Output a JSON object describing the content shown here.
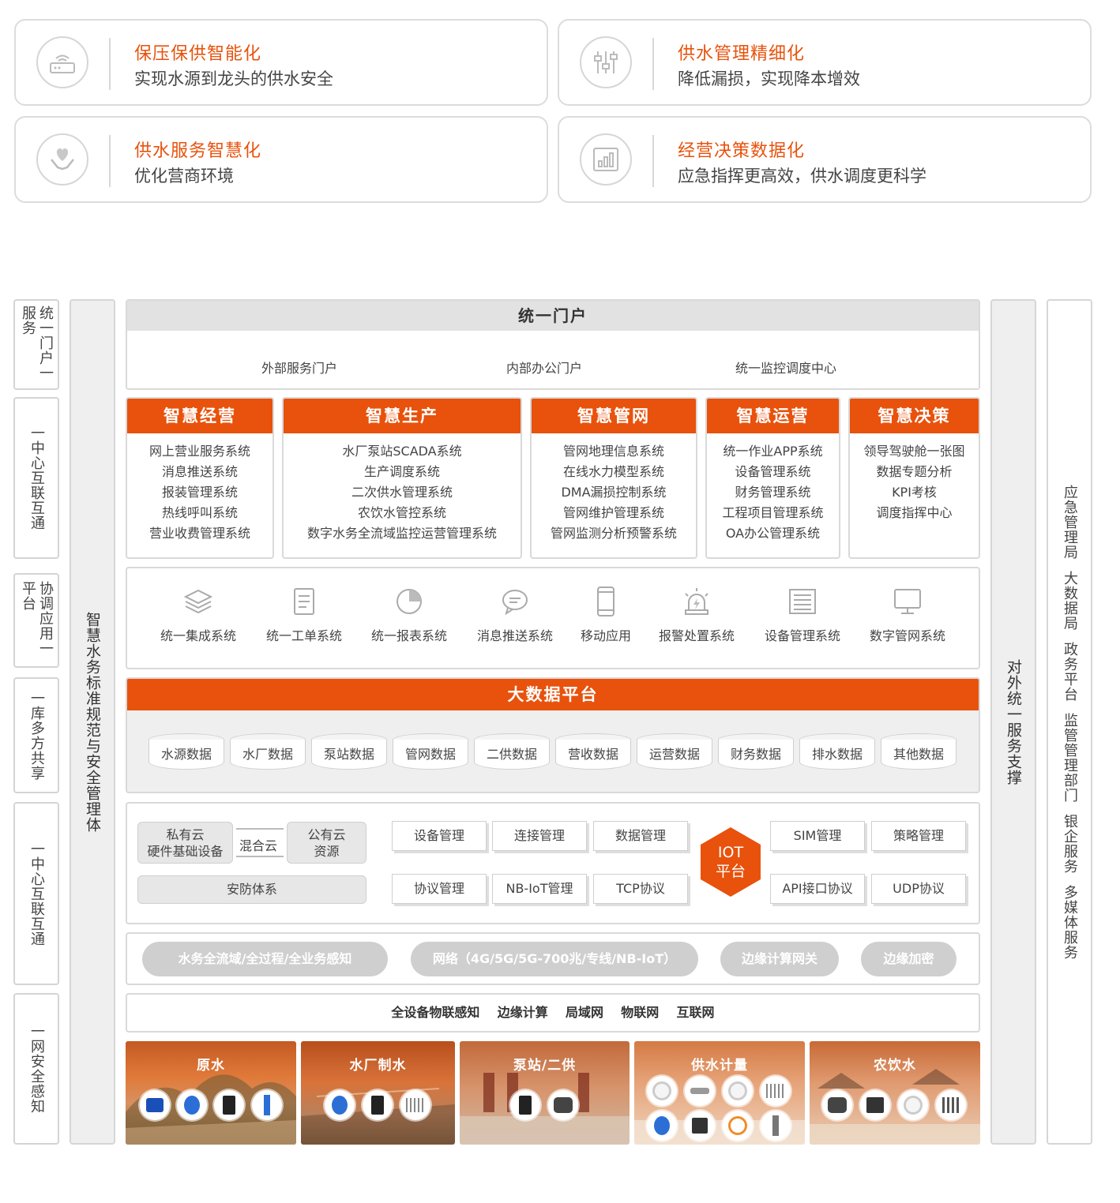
{
  "cards": [
    {
      "title": "保压保供智能化",
      "subtitle": "实现水源到龙头的供水安全",
      "icon": "router-icon"
    },
    {
      "title": "供水管理精细化",
      "subtitle": "降低漏损，实现降本增效",
      "icon": "sliders-icon"
    },
    {
      "title": "供水服务智慧化",
      "subtitle": "优化营商环境",
      "icon": "heart-hands-icon"
    },
    {
      "title": "经营决策数据化",
      "subtitle": "应急指挥更高效，供水调度更科学",
      "icon": "bar-chart-icon"
    }
  ],
  "left_labels": [
    "统一门户一服务",
    "一中心互联互通",
    "协调应用一平台",
    "一库多方共享",
    "一中心互联互通",
    "一网安全感知"
  ],
  "standards_column": "智慧水务标准规范与安全管理体",
  "portal": {
    "title": "统一门户",
    "items": [
      "外部服务门户",
      "内部办公门户",
      "统一监控调度中心"
    ]
  },
  "modules": [
    {
      "title": "智慧经营",
      "items": [
        "网上营业服务系统",
        "消息推送系统",
        "报装管理系统",
        "热线呼叫系统",
        "营业收费管理系统"
      ]
    },
    {
      "title": "智慧生产",
      "items": [
        "水厂泵站SCADA系统",
        "生产调度系统",
        "二次供水管理系统",
        "农饮水管控系统",
        "数字水务全流域监控运营管理系统"
      ]
    },
    {
      "title": "智慧管网",
      "items": [
        "管网地理信息系统",
        "在线水力模型系统",
        "DMA漏损控制系统",
        "管网维护管理系统",
        "管网监测分析预警系统"
      ]
    },
    {
      "title": "智慧运营",
      "items": [
        "统一作业APP系统",
        "设备管理系统",
        "财务管理系统",
        "工程项目管理系统",
        "OA办公管理系统"
      ]
    },
    {
      "title": "智慧决策",
      "items": [
        "领导驾驶舱一张图",
        "数据专题分析",
        "KPI考核",
        "调度指挥中心"
      ]
    }
  ],
  "apps": [
    {
      "label": "统一集成系统",
      "icon": "layers-icon"
    },
    {
      "label": "统一工单系统",
      "icon": "document-icon"
    },
    {
      "label": "统一报表系统",
      "icon": "pie-chart-icon"
    },
    {
      "label": "消息推送系统",
      "icon": "chat-bubble-icon"
    },
    {
      "label": "移动应用",
      "icon": "mobile-phone-icon"
    },
    {
      "label": "报警处置系统",
      "icon": "alarm-light-icon"
    },
    {
      "label": "设备管理系统",
      "icon": "list-panel-icon"
    },
    {
      "label": "数字管网系统",
      "icon": "monitor-icon"
    }
  ],
  "bigdata": {
    "title": "大数据平台",
    "items": [
      "水源数据",
      "水厂数据",
      "泵站数据",
      "管网数据",
      "二供数据",
      "营收数据",
      "运营数据",
      "财务数据",
      "排水数据",
      "其他数据"
    ]
  },
  "cloud": {
    "private_line1": "私有云",
    "private_line2": "硬件基础设备",
    "hybrid": "混合云",
    "public_line1": "公有云",
    "public_line2": "资源",
    "security": "安防体系"
  },
  "iot": {
    "hub_line1": "IOT",
    "hub_line2": "平台",
    "left_top": [
      "设备管理",
      "连接管理",
      "数据管理"
    ],
    "left_bottom": [
      "协议管理",
      "NB-IoT管理",
      "TCP协议"
    ],
    "right_top": [
      "SIM管理",
      "策略管理"
    ],
    "right_bottom": [
      "API接口协议",
      "UDP协议"
    ]
  },
  "network_pills": [
    "水务全流域/全过程/全业务感知",
    "网络（4G/5G/5G-700兆/专线/NB-IoT）",
    "边缘计算网关",
    "边缘加密"
  ],
  "sensing_line": "全设备物联感知    边缘计算    局域网    物联网    互联网",
  "scenes": [
    "原水",
    "水厂制水",
    "泵站/二供",
    "供水计量",
    "农饮水"
  ],
  "external_support": "对外统一服务支撑",
  "right_column": [
    "应急管理局",
    "大数据局",
    "政务平台",
    "监管管理部门",
    "银企服务",
    "多媒体服务"
  ],
  "colors": {
    "accent": "#e8520c",
    "grey_header": "#e2e2e2",
    "frame_bg": "#efefef"
  }
}
